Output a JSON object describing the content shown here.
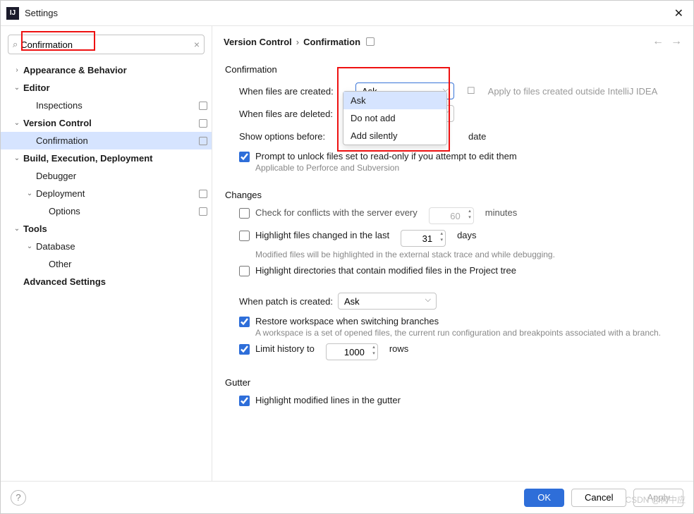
{
  "window": {
    "title": "Settings"
  },
  "search": {
    "value": "Confirmation",
    "placeholder": ""
  },
  "tree": {
    "appearance": "Appearance & Behavior",
    "editor": "Editor",
    "inspections": "Inspections",
    "version_control": "Version Control",
    "confirmation": "Confirmation",
    "build": "Build, Execution, Deployment",
    "debugger": "Debugger",
    "deployment": "Deployment",
    "options": "Options",
    "tools": "Tools",
    "database": "Database",
    "other": "Other",
    "advanced": "Advanced Settings"
  },
  "breadcrumb": {
    "a": "Version Control",
    "b": "Confirmation"
  },
  "sections": {
    "confirmation": "Confirmation",
    "changes": "Changes",
    "gutter": "Gutter"
  },
  "labels": {
    "files_created": "When files are created:",
    "files_deleted": "When files are deleted:",
    "show_options_before": "Show options before:",
    "apply_outside": "Apply to files created outside IntelliJ IDEA",
    "prompt_unlock": "Prompt to unlock files set to read-only if you attempt to edit them",
    "prompt_hint": "Applicable to Perforce and Subversion",
    "check_conflicts": "Check for conflicts with the server every",
    "minutes": "minutes",
    "highlight_files": "Highlight files changed in the last",
    "days": "days",
    "highlight_hint": "Modified files will be highlighted in the external stack trace and while debugging.",
    "highlight_dirs": "Highlight directories that contain modified files in the Project tree",
    "patch_created": "When patch is created:",
    "restore_ws": "Restore workspace when switching branches",
    "restore_hint": "A workspace is a set of opened files, the current run configuration and breakpoints associated with a branch.",
    "limit_history": "Limit history to",
    "rows": "rows",
    "highlight_gutter": "Highlight modified lines in the gutter",
    "trailing": "date"
  },
  "values": {
    "created": "Ask",
    "patch": "Ask",
    "conflict_minutes": "60",
    "highlight_days": "31",
    "history_rows": "1000"
  },
  "dropdown_options": {
    "o1": "Ask",
    "o2": "Do not add",
    "o3": "Add silently"
  },
  "buttons": {
    "ok": "OK",
    "cancel": "Cancel",
    "apply": "Apply"
  },
  "watermark": "CSDN @何中应"
}
